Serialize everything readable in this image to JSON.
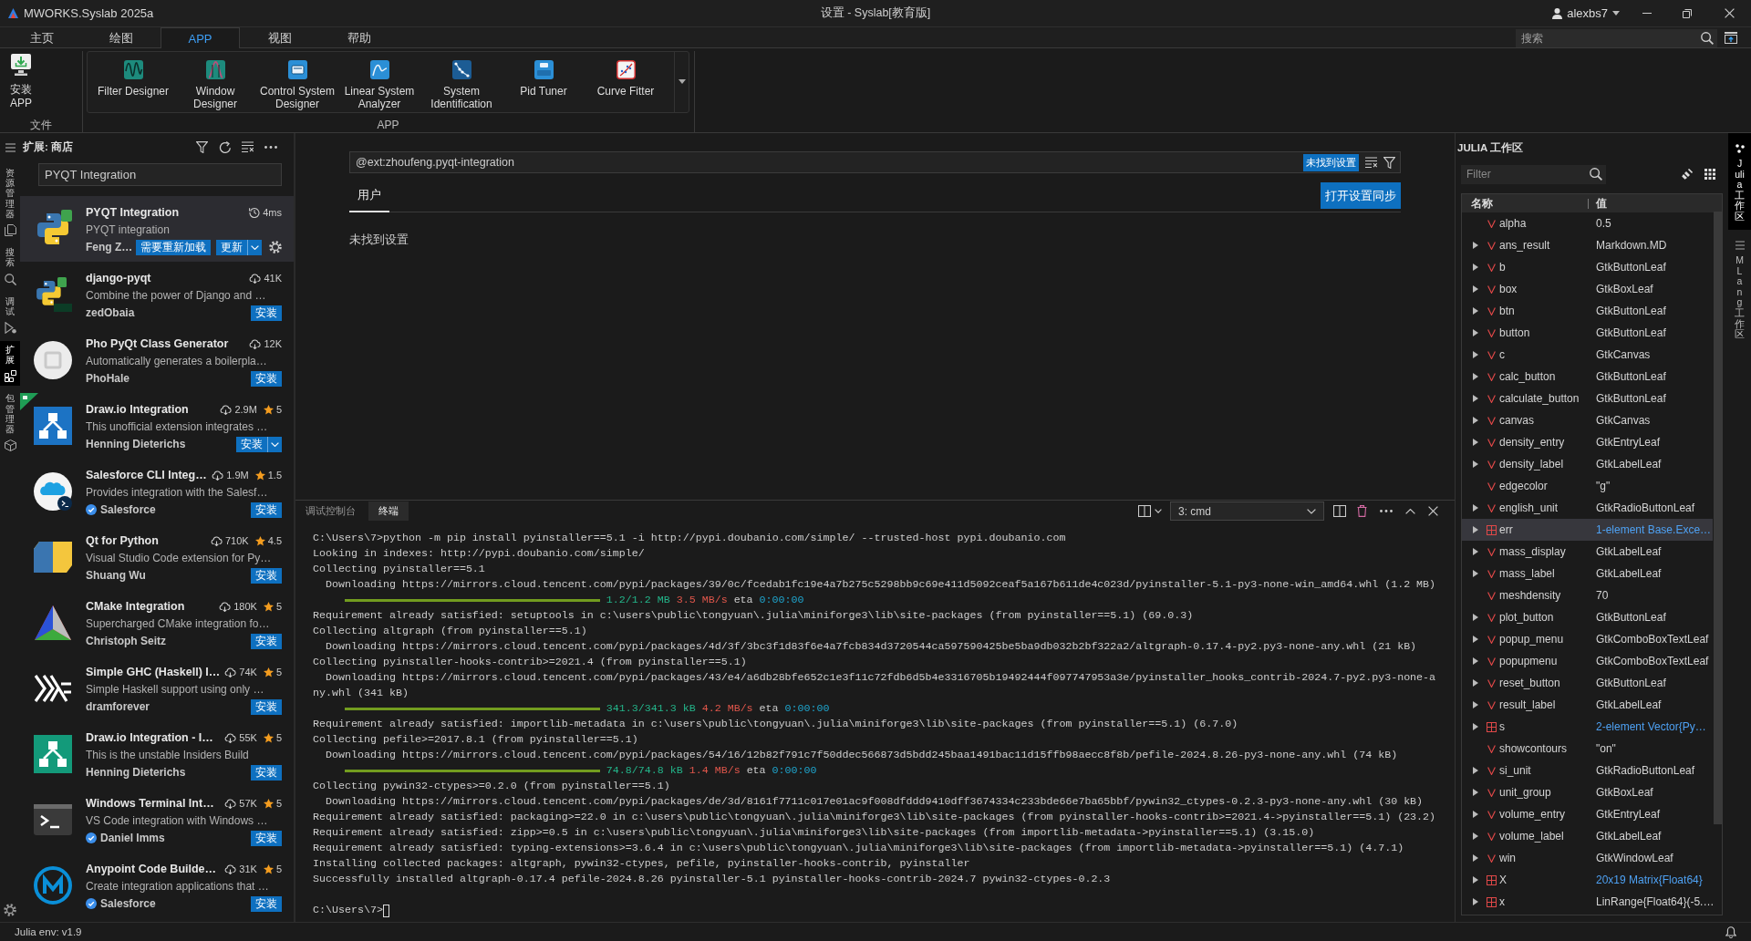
{
  "title_bar": {
    "app_name": "MWORKS.Syslab 2025a",
    "title": "设置 - Syslab[教育版]",
    "user": "alexbs7"
  },
  "menu_tabs": [
    {
      "label": "主页",
      "selected": false
    },
    {
      "label": "绘图",
      "selected": false
    },
    {
      "label": "APP",
      "selected": true
    },
    {
      "label": "视图",
      "selected": false
    },
    {
      "label": "帮助",
      "selected": false
    }
  ],
  "search": {
    "placeholder": "搜索"
  },
  "ribbon": {
    "groups": [
      {
        "kind": "file",
        "label": "文件",
        "buttons": [
          "安装 APP"
        ]
      },
      {
        "kind": "gallery",
        "label": "APP",
        "buttons": [
          "Filter Designer",
          "Window Designer",
          "Control System Designer",
          "Linear System Analyzer",
          "System Identification",
          "Pid Tuner",
          "Curve Fitter"
        ]
      }
    ]
  },
  "activity_bar": [
    {
      "label": "资源管理器",
      "selected": false
    },
    {
      "label": "搜索",
      "selected": false
    },
    {
      "label": "调试",
      "selected": false
    },
    {
      "label": "扩展",
      "selected": true
    },
    {
      "label": "包管理器",
      "selected": false
    }
  ],
  "extensions": {
    "title": "扩展: 商店",
    "search_value": "PYQT Integration",
    "items": [
      {
        "name": "PYQT Integration",
        "description": "PYQT integration",
        "publisher": "Feng Z…",
        "verified": false,
        "kind": "installed",
        "meta": "4ms",
        "status": "需要重新加载",
        "action": "更新",
        "split": true,
        "ribbon": false,
        "selected": true
      },
      {
        "name": "django-pyqt",
        "description": "Combine the power of Django and …",
        "publisher": "zedObaia",
        "verified": false,
        "kind": "marketplace",
        "meta": "41K",
        "action": "安装",
        "split": false,
        "ribbon": false,
        "selected": false
      },
      {
        "name": "Pho PyQt Class Generator",
        "description": "Automatically generates a boilerpla…",
        "publisher": "PhoHale",
        "verified": false,
        "kind": "marketplace",
        "meta": "12K",
        "action": "安装",
        "split": false,
        "ribbon": false,
        "selected": false
      },
      {
        "name": "Draw.io Integration",
        "description": "This unofficial extension integrates …",
        "publisher": "Henning Dieterichs",
        "verified": false,
        "kind": "marketplace",
        "meta": "2.9M",
        "rating": "5",
        "action": "安装",
        "split": true,
        "ribbon": true,
        "selected": false
      },
      {
        "name": "Salesforce CLI Integ…",
        "description": "Provides integration with the Salesf…",
        "publisher": "Salesforce",
        "verified": true,
        "kind": "marketplace",
        "meta": "1.9M",
        "rating": "1.5",
        "action": "安装",
        "split": false,
        "ribbon": false,
        "selected": false
      },
      {
        "name": "Qt for Python",
        "description": "Visual Studio Code extension for Py…",
        "publisher": "Shuang Wu",
        "verified": false,
        "kind": "marketplace",
        "meta": "710K",
        "rating": "4.5",
        "action": "安装",
        "split": false,
        "ribbon": false,
        "selected": false
      },
      {
        "name": "CMake Integration",
        "description": "Supercharged CMake integration fo…",
        "publisher": "Christoph Seitz",
        "verified": false,
        "kind": "marketplace",
        "meta": "180K",
        "rating": "5",
        "action": "安装",
        "split": false,
        "ribbon": false,
        "selected": false
      },
      {
        "name": "Simple GHC (Haskell) I…",
        "description": "Simple Haskell support using only …",
        "publisher": "dramforever",
        "verified": false,
        "kind": "marketplace",
        "meta": "74K",
        "rating": "5",
        "action": "安装",
        "split": false,
        "ribbon": false,
        "selected": false
      },
      {
        "name": "Draw.io Integration - I…",
        "description": "This is the unstable Insiders Build",
        "publisher": "Henning Dieterichs",
        "verified": false,
        "kind": "marketplace",
        "meta": "55K",
        "rating": "5",
        "action": "安装",
        "split": false,
        "ribbon": false,
        "selected": false
      },
      {
        "name": "Windows Terminal Int…",
        "description": "VS Code integration with Windows …",
        "publisher": "Daniel Imms",
        "verified": true,
        "kind": "marketplace",
        "meta": "57K",
        "rating": "5",
        "action": "安装",
        "split": false,
        "ribbon": false,
        "selected": false
      },
      {
        "name": "Anypoint Code Builde…",
        "description": "Create integration applications that …",
        "publisher": "Salesforce",
        "verified": true,
        "kind": "marketplace",
        "meta": "31K",
        "rating": "5",
        "action": "安装",
        "split": false,
        "ribbon": false,
        "selected": false
      }
    ]
  },
  "settings": {
    "search_value": "@ext:zhoufeng.pyqt-integration",
    "result_badge": "未找到设置",
    "tabs": [
      {
        "label": "用户",
        "selected": true
      }
    ],
    "sync_button": "打开设置同步",
    "message": "未找到设置"
  },
  "panel": {
    "tabs": [
      {
        "label": "调试控制台",
        "selected": false
      },
      {
        "label": "终端",
        "selected": true
      }
    ],
    "terminal_select": "3: cmd",
    "lines": [
      {
        "kind": "text",
        "text": "C:\\Users\\7>python -m pip install pyinstaller==5.1 -i http://pypi.doubanio.com/simple/ --trusted-host pypi.doubanio.com"
      },
      {
        "kind": "text",
        "text": "Looking in indexes: http://pypi.doubanio.com/simple/"
      },
      {
        "kind": "text",
        "text": "Collecting pyinstaller==5.1"
      },
      {
        "kind": "text",
        "text": "  Downloading https://mirrors.cloud.tencent.com/pypi/packages/39/0c/fcedab1fc19e4a7b275c5298bb9c69e411d5092ceaf5a167b611de4c023d/pyinstaller-5.1-py3-none-win_amd64.whl (1.2 MB)"
      },
      {
        "kind": "progress",
        "level": 1,
        "size": "1.2/1.2 MB",
        "speed": "3.5 MB/s",
        "eta_label": "eta",
        "eta": "0:00:00"
      },
      {
        "kind": "text",
        "text": "Requirement already satisfied: setuptools in c:\\users\\public\\tongyuan\\.julia\\miniforge3\\lib\\site-packages (from pyinstaller==5.1) (69.0.3)"
      },
      {
        "kind": "text",
        "text": "Collecting altgraph (from pyinstaller==5.1)"
      },
      {
        "kind": "text",
        "text": "  Downloading https://mirrors.cloud.tencent.com/pypi/packages/4d/3f/3bc3f1d83f6e4a7fcb834d3720544ca597590425be5ba9db032b2bf322a2/altgraph-0.17.4-py2.py3-none-any.whl (21 kB)"
      },
      {
        "kind": "text",
        "text": "Collecting pyinstaller-hooks-contrib>=2021.4 (from pyinstaller==5.1)"
      },
      {
        "kind": "text",
        "text": "  Downloading https://mirrors.cloud.tencent.com/pypi/packages/43/e4/a6db28bfe652c1e3f11c72fdb6d5b4e3316705b19492444f097747953a3e/pyinstaller_hooks_contrib-2024.7-py2.py3-none-a"
      },
      {
        "kind": "text",
        "text": "ny.whl (341 kB)"
      },
      {
        "kind": "progress",
        "level": 1,
        "size": "341.3/341.3 kB",
        "speed": "4.2 MB/s",
        "eta_label": "eta",
        "eta": "0:00:00"
      },
      {
        "kind": "text",
        "text": "Requirement already satisfied: importlib-metadata in c:\\users\\public\\tongyuan\\.julia\\miniforge3\\lib\\site-packages (from pyinstaller==5.1) (6.7.0)"
      },
      {
        "kind": "text",
        "text": "Collecting pefile>=2017.8.1 (from pyinstaller==5.1)"
      },
      {
        "kind": "text",
        "text": "  Downloading https://mirrors.cloud.tencent.com/pypi/packages/54/16/12b82f791c7f50ddec566873d5bdd245baa1491bac11d15ffb98aecc8f8b/pefile-2024.8.26-py3-none-any.whl (74 kB)"
      },
      {
        "kind": "progress",
        "level": 1,
        "size": "74.8/74.8 kB",
        "speed": "1.4 MB/s",
        "eta_label": "eta",
        "eta": "0:00:00"
      },
      {
        "kind": "text",
        "text": "Collecting pywin32-ctypes>=0.2.0 (from pyinstaller==5.1)"
      },
      {
        "kind": "text",
        "text": "  Downloading https://mirrors.cloud.tencent.com/pypi/packages/de/3d/8161f7711c017e01ac9f008dfddd9410dff3674334c233bde66e7ba65bbf/pywin32_ctypes-0.2.3-py3-none-any.whl (30 kB)"
      },
      {
        "kind": "text",
        "text": "Requirement already satisfied: packaging>=22.0 in c:\\users\\public\\tongyuan\\.julia\\miniforge3\\lib\\site-packages (from pyinstaller-hooks-contrib>=2021.4->pyinstaller==5.1) (23.2)"
      },
      {
        "kind": "text",
        "text": "Requirement already satisfied: zipp>=0.5 in c:\\users\\public\\tongyuan\\.julia\\miniforge3\\lib\\site-packages (from importlib-metadata->pyinstaller==5.1) (3.15.0)"
      },
      {
        "kind": "text",
        "text": "Requirement already satisfied: typing-extensions>=3.6.4 in c:\\users\\public\\tongyuan\\.julia\\miniforge3\\lib\\site-packages (from importlib-metadata->pyinstaller==5.1) (4.7.1)"
      },
      {
        "kind": "text",
        "text": "Installing collected packages: altgraph, pywin32-ctypes, pefile, pyinstaller-hooks-contrib, pyinstaller"
      },
      {
        "kind": "text",
        "text": "Successfully installed altgraph-0.17.4 pefile-2024.8.26 pyinstaller-5.1 pyinstaller-hooks-contrib-2024.7 pywin32-ctypes-0.2.3"
      },
      {
        "kind": "blank"
      },
      {
        "kind": "prompt",
        "text": "C:\\Users\\7>"
      }
    ]
  },
  "workspace": {
    "title": "JULIA 工作区",
    "filter_placeholder": "Filter",
    "columns": [
      "名称",
      "值"
    ],
    "rows": [
      {
        "name": "alpha",
        "value": "0.5",
        "kind": "variable",
        "expandable": false,
        "link": false,
        "selected": false
      },
      {
        "name": "ans_result",
        "value": "Markdown.MD",
        "kind": "variable",
        "expandable": true,
        "link": false,
        "selected": false
      },
      {
        "name": "b",
        "value": "GtkButtonLeaf",
        "kind": "variable",
        "expandable": true,
        "link": false,
        "selected": false
      },
      {
        "name": "box",
        "value": "GtkBoxLeaf",
        "kind": "variable",
        "expandable": true,
        "link": false,
        "selected": false
      },
      {
        "name": "btn",
        "value": "GtkButtonLeaf",
        "kind": "variable",
        "expandable": true,
        "link": false,
        "selected": false
      },
      {
        "name": "button",
        "value": "GtkButtonLeaf",
        "kind": "variable",
        "expandable": true,
        "link": false,
        "selected": false
      },
      {
        "name": "c",
        "value": "GtkCanvas",
        "kind": "variable",
        "expandable": true,
        "link": false,
        "selected": false
      },
      {
        "name": "calc_button",
        "value": "GtkButtonLeaf",
        "kind": "variable",
        "expandable": true,
        "link": false,
        "selected": false
      },
      {
        "name": "calculate_button",
        "value": "GtkButtonLeaf",
        "kind": "variable",
        "expandable": true,
        "link": false,
        "selected": false
      },
      {
        "name": "canvas",
        "value": "GtkCanvas",
        "kind": "variable",
        "expandable": true,
        "link": false,
        "selected": false
      },
      {
        "name": "density_entry",
        "value": "GtkEntryLeaf",
        "kind": "variable",
        "expandable": true,
        "link": false,
        "selected": false
      },
      {
        "name": "density_label",
        "value": "GtkLabelLeaf",
        "kind": "variable",
        "expandable": true,
        "link": false,
        "selected": false
      },
      {
        "name": "edgecolor",
        "value": "\"g\"",
        "kind": "variable",
        "expandable": false,
        "link": false,
        "selected": false
      },
      {
        "name": "english_unit",
        "value": "GtkRadioButtonLeaf",
        "kind": "variable",
        "expandable": true,
        "link": false,
        "selected": false
      },
      {
        "name": "err",
        "value": "1-element Base.Exce…",
        "kind": "array",
        "expandable": true,
        "link": true,
        "selected": true
      },
      {
        "name": "mass_display",
        "value": "GtkLabelLeaf",
        "kind": "variable",
        "expandable": true,
        "link": false,
        "selected": false
      },
      {
        "name": "mass_label",
        "value": "GtkLabelLeaf",
        "kind": "variable",
        "expandable": true,
        "link": false,
        "selected": false
      },
      {
        "name": "meshdensity",
        "value": "70",
        "kind": "variable",
        "expandable": false,
        "link": false,
        "selected": false
      },
      {
        "name": "plot_button",
        "value": "GtkButtonLeaf",
        "kind": "variable",
        "expandable": true,
        "link": false,
        "selected": false
      },
      {
        "name": "popup_menu",
        "value": "GtkComboBoxTextLeaf",
        "kind": "variable",
        "expandable": true,
        "link": false,
        "selected": false
      },
      {
        "name": "popupmenu",
        "value": "GtkComboBoxTextLeaf",
        "kind": "variable",
        "expandable": true,
        "link": false,
        "selected": false
      },
      {
        "name": "reset_button",
        "value": "GtkButtonLeaf",
        "kind": "variable",
        "expandable": true,
        "link": false,
        "selected": false
      },
      {
        "name": "result_label",
        "value": "GtkLabelLeaf",
        "kind": "variable",
        "expandable": true,
        "link": false,
        "selected": false
      },
      {
        "name": "s",
        "value": "2-element Vector{Py…",
        "kind": "array",
        "expandable": true,
        "link": true,
        "selected": false
      },
      {
        "name": "showcontours",
        "value": "\"on\"",
        "kind": "variable",
        "expandable": false,
        "link": false,
        "selected": false
      },
      {
        "name": "si_unit",
        "value": "GtkRadioButtonLeaf",
        "kind": "variable",
        "expandable": true,
        "link": false,
        "selected": false
      },
      {
        "name": "unit_group",
        "value": "GtkBoxLeaf",
        "kind": "variable",
        "expandable": true,
        "link": false,
        "selected": false
      },
      {
        "name": "volume_entry",
        "value": "GtkEntryLeaf",
        "kind": "variable",
        "expandable": true,
        "link": false,
        "selected": false
      },
      {
        "name": "volume_label",
        "value": "GtkLabelLeaf",
        "kind": "variable",
        "expandable": true,
        "link": false,
        "selected": false
      },
      {
        "name": "win",
        "value": "GtkWindowLeaf",
        "kind": "variable",
        "expandable": true,
        "link": false,
        "selected": false
      },
      {
        "name": "X",
        "value": "20x19 Matrix{Float64}",
        "kind": "array",
        "expandable": true,
        "link": true,
        "selected": false
      },
      {
        "name": "x",
        "value": "LinRange{Float64}(-5.…",
        "kind": "array",
        "expandable": true,
        "link": false,
        "selected": false
      }
    ]
  },
  "right_bar": [
    {
      "label": "Julia 工作区",
      "selected": true
    },
    {
      "label": "MLang 工作区",
      "selected": false
    }
  ],
  "status_bar": {
    "env": "Julia env: v1.9"
  }
}
